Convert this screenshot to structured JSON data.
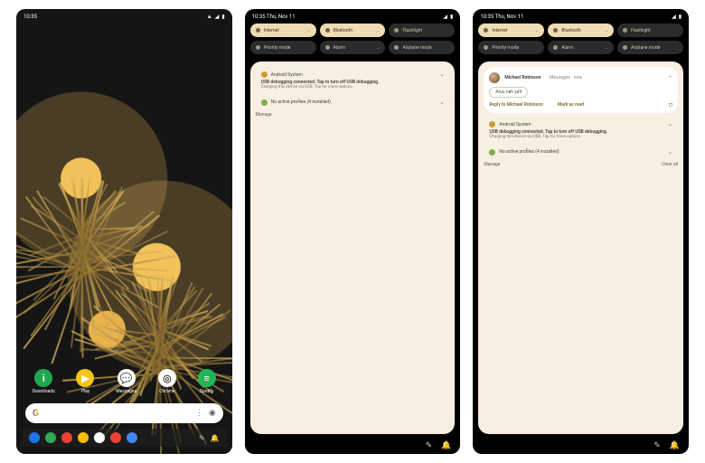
{
  "status": {
    "time": "10:35",
    "date": "Thu, Nov 11"
  },
  "home": {
    "apps": [
      {
        "label": "Downloads",
        "bg": "#1fa84f",
        "glyph": "i"
      },
      {
        "label": "Play",
        "bg": "#f5c518",
        "glyph": "▶"
      },
      {
        "label": "Messages",
        "bg": "#ffffff",
        "glyph": "💬"
      },
      {
        "label": "Chrome",
        "bg": "#ffffff",
        "glyph": "◎"
      },
      {
        "label": "Spotify",
        "bg": "#1db954",
        "glyph": "≡"
      }
    ],
    "search_brand": "G"
  },
  "taskbar": {
    "icons": [
      "#1a73e8",
      "#34a853",
      "#ea4335",
      "#fbbc05",
      "#ffffff",
      "#ea4335",
      "#4285f4"
    ]
  },
  "qs": [
    {
      "label": "Internet",
      "on": true,
      "chev": true
    },
    {
      "label": "Bluetooth",
      "on": true,
      "chev": true
    },
    {
      "label": "Flashlight",
      "on": false,
      "chev": false
    }
  ],
  "qs2": [
    {
      "label": "Priority mode",
      "on": false,
      "chev": false
    },
    {
      "label": "Alarm",
      "on": false,
      "chev": true
    },
    {
      "label": "Airplane mode",
      "on": false,
      "chev": false
    }
  ],
  "convo": {
    "name": "Michael Robinson",
    "app": "Messages",
    "when": "now",
    "msg": "Arus neh ya'll",
    "reply": "Reply to Michael Robinson",
    "mark": "Mark as read"
  },
  "sys_notif": {
    "app": "Android System",
    "title": "USB debugging connected. Tap to turn off USB debugging.",
    "body": "Charging this device via USB. Tap for more options."
  },
  "profile_notif": {
    "title": "No active profiles (4 installed)"
  },
  "footer": {
    "manage": "Manage",
    "clear": "Clear all"
  },
  "nav": {
    "pen": "✎",
    "bell": "🔔"
  }
}
